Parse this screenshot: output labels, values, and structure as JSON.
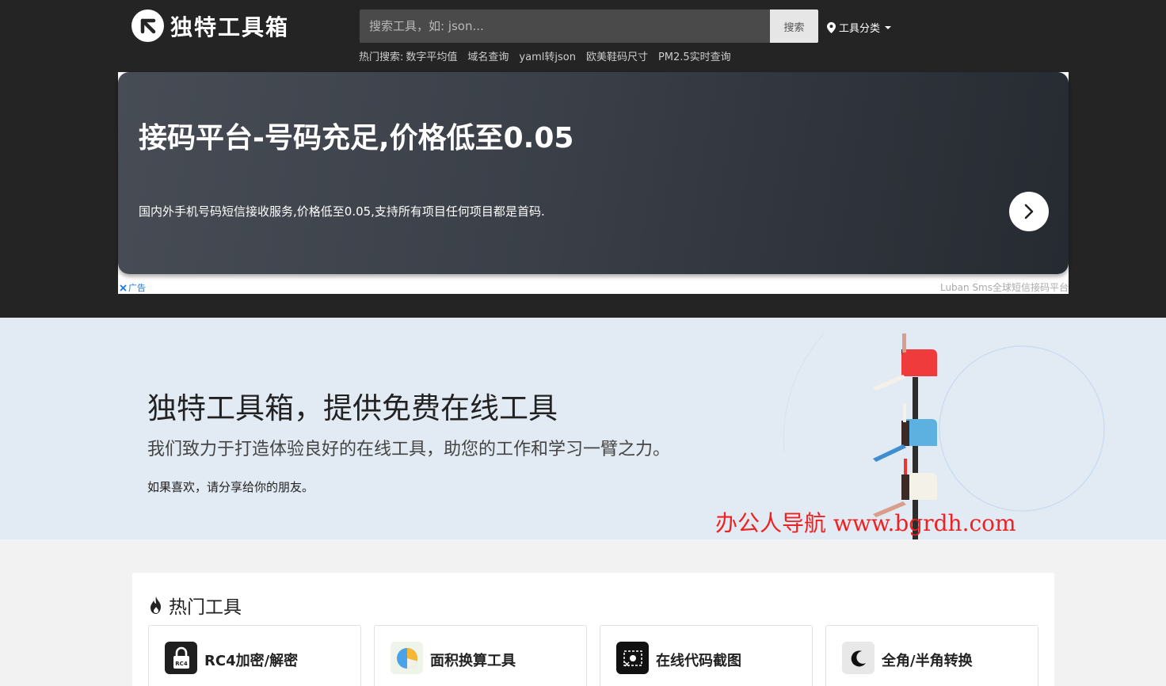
{
  "header": {
    "site_name": "独特工具箱",
    "search_placeholder": "搜索工具，如: json...",
    "search_button": "搜索",
    "category_label": "工具分类",
    "hot_search_label": "热门搜索:",
    "hot_search_links": [
      "数字平均值",
      "域名查询",
      "yaml转json",
      "欧美鞋码尺寸",
      "PM2.5实时查询"
    ]
  },
  "ad": {
    "title": "接码平台-号码充足,价格低至0.05",
    "description": "国内外手机号码短信接收服务,价格低至0.05,支持所有项目任何项目都是首码.",
    "tag": "广告",
    "source": "Luban Sms全球短信接码平台"
  },
  "hero": {
    "title": "独特工具箱，提供免费在线工具",
    "subtitle": "我们致力于打造体验良好的在线工具，助您的工作和学习一臂之力。",
    "share_text": "如果喜欢，请分享给你的朋友。",
    "watermark": "办公人导航 www.bgrdh.com"
  },
  "hot_tools": {
    "heading": "热门工具",
    "items": [
      {
        "name": "RC4加密/解密",
        "icon": "lock-rc4-icon"
      },
      {
        "name": "面积换算工具",
        "icon": "pie-chart-icon"
      },
      {
        "name": "在线代码截图",
        "icon": "screenshot-icon"
      },
      {
        "name": "全角/半角转换",
        "icon": "moon-icon"
      }
    ]
  },
  "colors": {
    "header_bg": "#242424",
    "hero_bg": "#e2eaf3",
    "watermark": "#e22222",
    "ad_tag": "#1a73e8"
  }
}
